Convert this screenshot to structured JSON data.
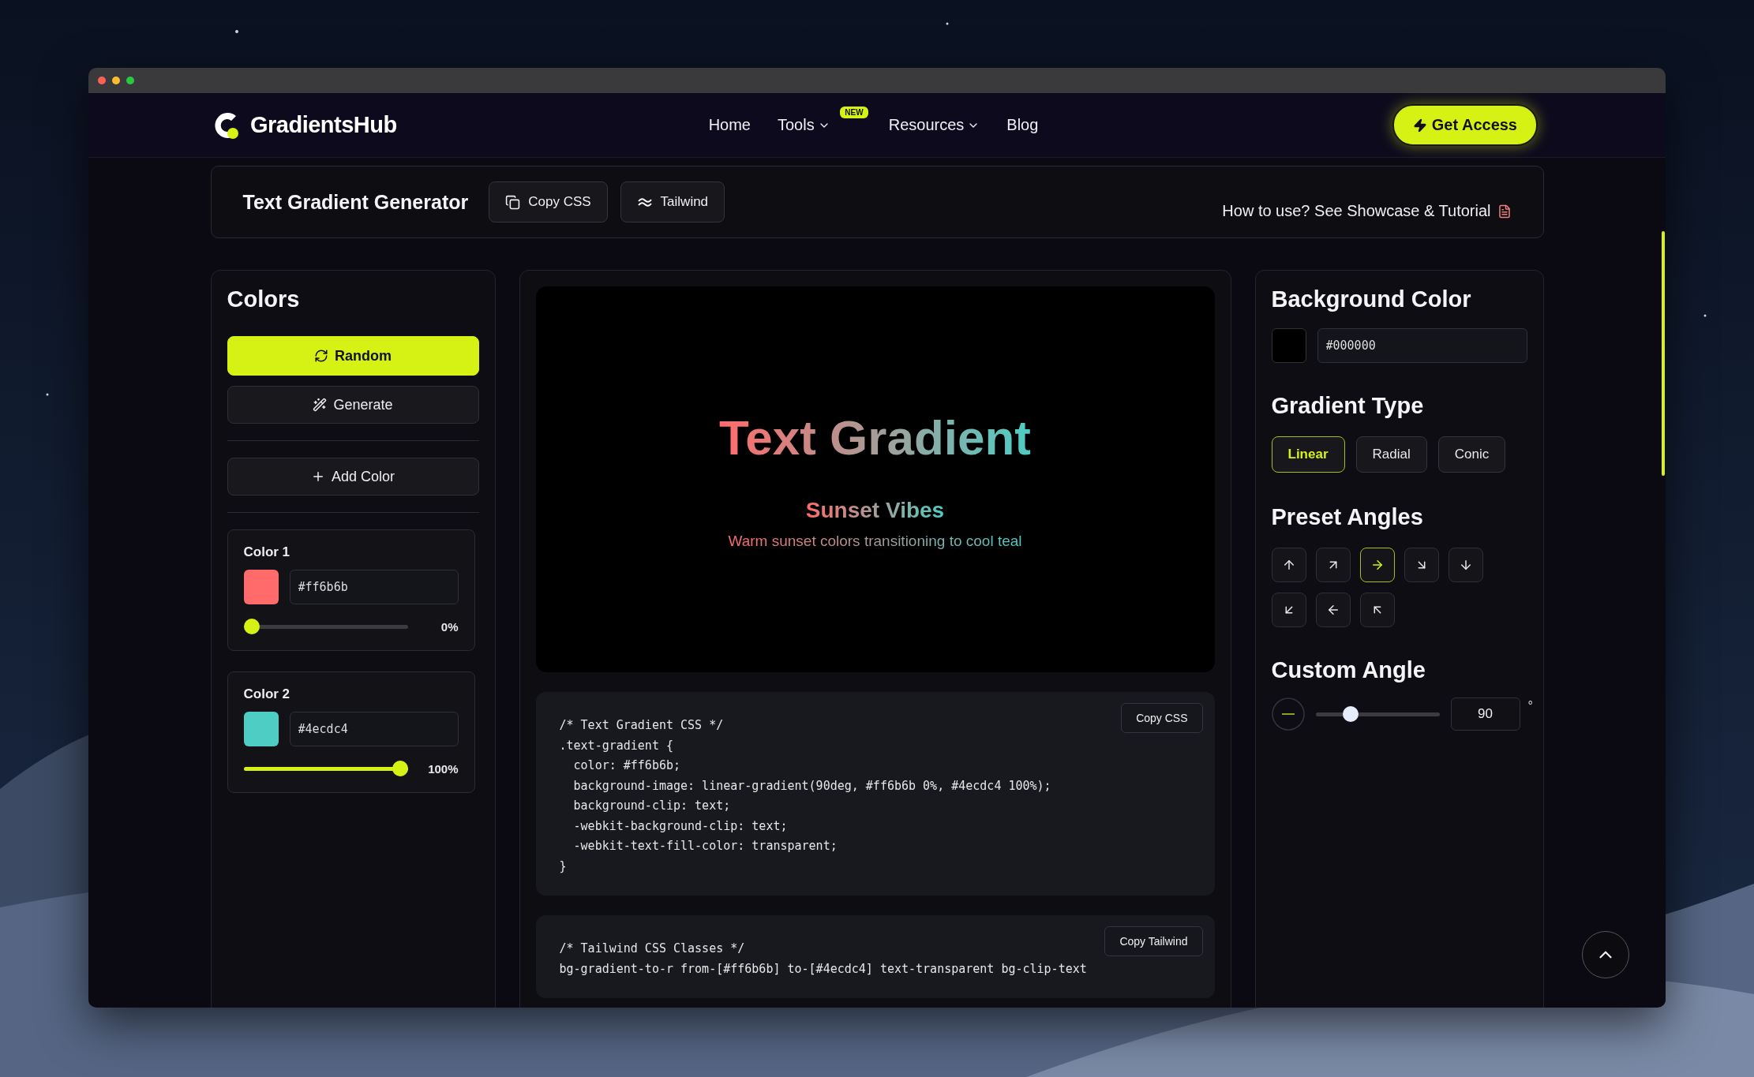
{
  "nav": {
    "brand": "GradientsHub",
    "links": [
      {
        "label": "Home",
        "dropdown": false
      },
      {
        "label": "Tools",
        "dropdown": true,
        "badge": "NEW"
      },
      {
        "label": "Resources",
        "dropdown": true
      },
      {
        "label": "Blog",
        "dropdown": false
      }
    ],
    "cta": "Get Access"
  },
  "toolbar": {
    "title": "Text Gradient Generator",
    "buttons": [
      {
        "label": "Copy CSS"
      },
      {
        "label": "Tailwind"
      }
    ],
    "help": "How to use? See Showcase & Tutorial"
  },
  "colors_panel": {
    "title": "Colors",
    "actions": [
      {
        "label": "Random",
        "kind": "primary"
      },
      {
        "label": "Generate",
        "kind": "secondary"
      }
    ],
    "add_button": "Add Color",
    "stops": [
      {
        "name": "Color 1",
        "color": "#ff6b6b",
        "hex": "#ff6b6b",
        "level": 0,
        "reading": "0%"
      },
      {
        "name": "Color 2",
        "color": "#4ecdc4",
        "hex": "#4ecdc4",
        "level": 1,
        "reading": "100%"
      }
    ]
  },
  "preview": {
    "title": "Text Gradient",
    "subtitle": "Sunset Vibes",
    "description": "Warm sunset colors transitioning to cool teal"
  },
  "css_code": {
    "button": "Copy CSS",
    "lines": [
      "/* Text Gradient CSS */",
      ".text-gradient {",
      "  color: #ff6b6b;",
      "  background-image: linear-gradient(90deg, #ff6b6b 0%, #4ecdc4 100%);",
      "  background-clip: text;",
      "  -webkit-background-clip: text;",
      "  -webkit-text-fill-color: transparent;",
      "}"
    ]
  },
  "tailwind_code": {
    "button": "Copy Tailwind",
    "lines": [
      "/* Tailwind CSS Classes */",
      "bg-gradient-to-r from-[#ff6b6b] to-[#4ecdc4] text-transparent bg-clip-text"
    ]
  },
  "settings": {
    "background": {
      "title": "Background Color",
      "color": "#000000",
      "value": "#000000"
    },
    "gradient_type": {
      "title": "Gradient Type",
      "options": [
        {
          "label": "Linear",
          "selected": true
        },
        {
          "label": "Radial",
          "selected": false
        },
        {
          "label": "Conic",
          "selected": false
        }
      ]
    },
    "preset_angles": {
      "title": "Preset Angles",
      "options": [
        {
          "kind": "n",
          "selected": false
        },
        {
          "kind": "ne",
          "selected": false
        },
        {
          "kind": "e",
          "selected": true
        },
        {
          "kind": "se",
          "selected": false
        },
        {
          "kind": "s",
          "selected": false
        },
        {
          "kind": "sw",
          "selected": false
        },
        {
          "kind": "w",
          "selected": false
        },
        {
          "kind": "nw",
          "selected": false
        }
      ]
    },
    "custom_angle": {
      "title": "Custom Angle",
      "level": 0.25,
      "value": "90",
      "unit": "°"
    }
  }
}
